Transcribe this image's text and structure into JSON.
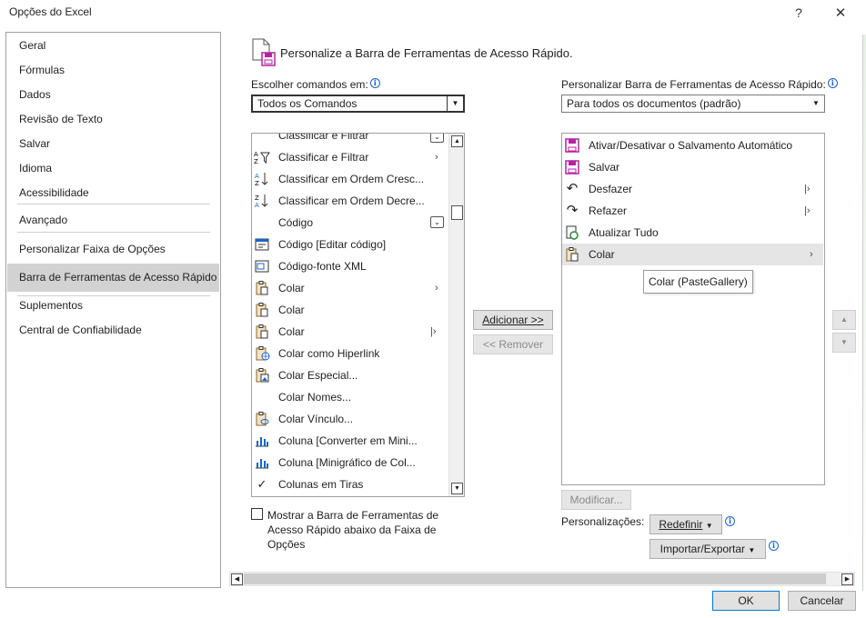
{
  "window": {
    "title": "Opções do Excel",
    "help_label": "?",
    "close_label": "✕"
  },
  "nav": {
    "items": [
      {
        "label": "Geral"
      },
      {
        "label": "Fórmulas"
      },
      {
        "label": "Dados"
      },
      {
        "label": "Revisão de Texto"
      },
      {
        "label": "Salvar"
      },
      {
        "label": "Idioma"
      },
      {
        "label": "Acessibilidade"
      },
      {
        "label": "Avançado"
      },
      {
        "label": "Personalizar Faixa de Opções"
      },
      {
        "label": "Barra de Ferramentas de Acesso Rápido",
        "selected": true
      },
      {
        "label": "Suplementos"
      },
      {
        "label": "Central de Confiabilidade"
      }
    ]
  },
  "header": {
    "title": "Personalize a Barra de Ferramentas de Acesso Rápido."
  },
  "choose": {
    "label": "Escolher comandos em:",
    "value": "Todos os Comandos"
  },
  "customize": {
    "label": "Personalizar Barra de Ferramentas de Acesso Rápido:",
    "value": "Para todos os documentos (padrão)"
  },
  "commands": {
    "items": [
      {
        "icon": "",
        "label": "Classificar e Filtrar",
        "extra": "dropdown"
      },
      {
        "icon": "sort-filter-icon",
        "label": "Classificar e Filtrar",
        "extra": "submenu"
      },
      {
        "icon": "sort-az-icon",
        "label": "Classificar em Ordem Cresc..."
      },
      {
        "icon": "sort-za-icon",
        "label": "Classificar em Ordem Decre..."
      },
      {
        "icon": "",
        "label": "Código",
        "extra": "dropdown"
      },
      {
        "icon": "edit-code-icon",
        "label": "Código [Editar código]"
      },
      {
        "icon": "xml-source-icon",
        "label": "Código-fonte XML"
      },
      {
        "icon": "paste-icon",
        "label": "Colar",
        "extra": "submenu"
      },
      {
        "icon": "paste-icon",
        "label": "Colar"
      },
      {
        "icon": "paste-icon",
        "label": "Colar",
        "extra": "split"
      },
      {
        "icon": "paste-hyperlink-icon",
        "label": "Colar como Hiperlink"
      },
      {
        "icon": "paste-special-icon",
        "label": "Colar Especial..."
      },
      {
        "icon": "",
        "label": "Colar Nomes..."
      },
      {
        "icon": "paste-link-icon",
        "label": "Colar Vínculo..."
      },
      {
        "icon": "column-chart-icon",
        "label": "Coluna [Converter em Mini..."
      },
      {
        "icon": "column-chart-icon",
        "label": "Coluna [Minigráfico de Col..."
      },
      {
        "icon": "check-icon",
        "label": "Colunas em Tiras"
      }
    ]
  },
  "qat": {
    "items": [
      {
        "icon": "autosave-icon",
        "label": "Ativar/Desativar o Salvamento Automático"
      },
      {
        "icon": "save-icon",
        "label": "Salvar"
      },
      {
        "icon": "undo-icon",
        "label": "Desfazer",
        "extra": "split"
      },
      {
        "icon": "redo-icon",
        "label": "Refazer",
        "extra": "split"
      },
      {
        "icon": "refresh-all-icon",
        "label": "Atualizar Tudo"
      },
      {
        "icon": "paste-icon",
        "label": "Colar",
        "extra": "submenu",
        "selected": true
      }
    ],
    "tooltip": "Colar (PasteGallery)"
  },
  "buttons": {
    "add": "Adicionar >>",
    "remove": "<< Remover",
    "modify": "Modificar...",
    "reset": "Redefinir",
    "import_export": "Importar/Exportar",
    "ok": "OK",
    "cancel": "Cancelar"
  },
  "show_below": {
    "label": "Mostrar a Barra de Ferramentas de Acesso Rápido abaixo da Faixa de Opções",
    "checked": false
  },
  "customizations_label": "Personalizações:",
  "colors": {
    "selected_nav": "#d2d2d2",
    "selected_row": "#e5e5e5",
    "save_purple": "#b4249f",
    "info_blue": "#1a64c8",
    "default_button_border": "#0078d7"
  }
}
